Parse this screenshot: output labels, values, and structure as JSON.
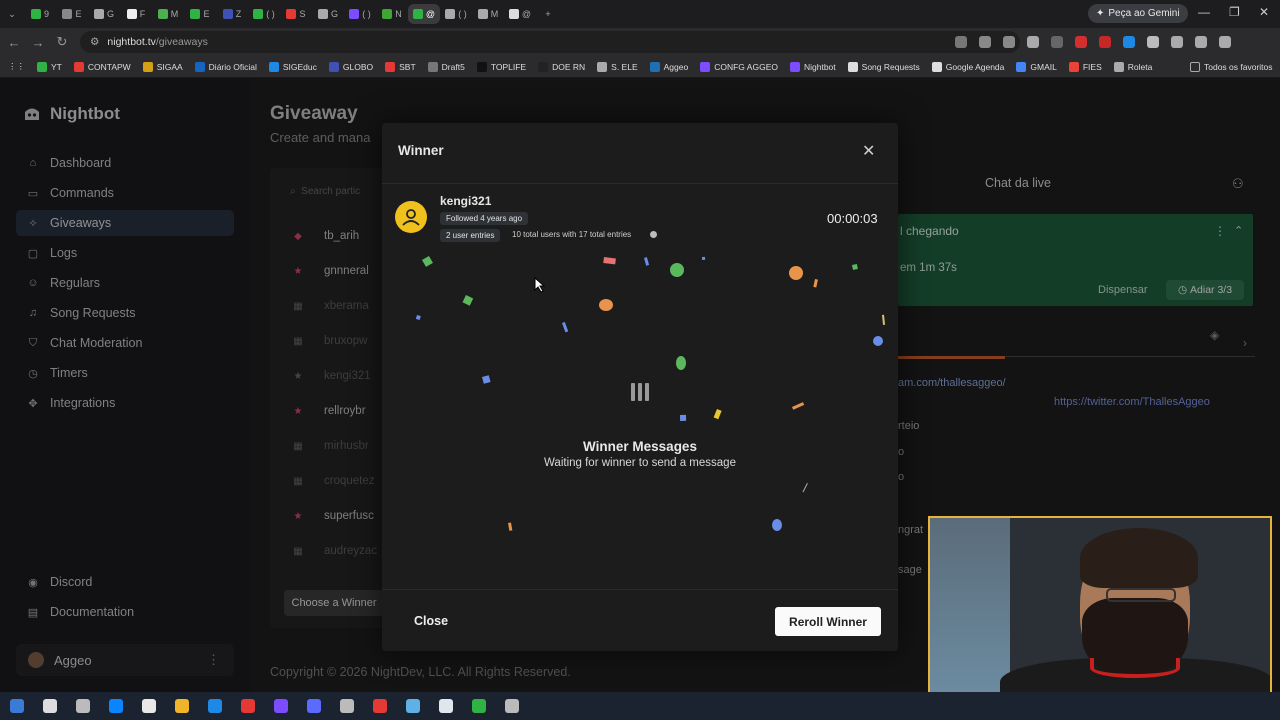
{
  "browser": {
    "url_host": "nightbot.tv",
    "url_path": "/giveaways",
    "gemini_label": "Peça ao Gemini",
    "tabs": [
      "9",
      "Ε",
      "G",
      "F",
      "M",
      "E",
      "Z",
      "( )",
      "S",
      "G",
      "( )",
      "N",
      "@",
      "( )",
      "M",
      "@"
    ],
    "bookmarks": [
      "YT",
      "CONTAPW",
      "SIGAA",
      "Diário Oficial",
      "SIGEduc",
      "GLOBO",
      "SBT",
      "Draft5",
      "TOPLIFE",
      "DOE RN",
      "S. ELE",
      "Aggeo",
      "CONFG AGGEO",
      "Nightbot",
      "Song Requests",
      "Google Agenda",
      "GMAIL",
      "FIES",
      "Roleta"
    ],
    "all_favorites": "Todos os favoritos"
  },
  "sidebar": {
    "logo": "Nightbot",
    "items": [
      {
        "label": "Dashboard",
        "icon": "home-icon"
      },
      {
        "label": "Commands",
        "icon": "terminal-icon"
      },
      {
        "label": "Giveaways",
        "icon": "gift-icon"
      },
      {
        "label": "Logs",
        "icon": "chat-icon"
      },
      {
        "label": "Regulars",
        "icon": "users-icon"
      },
      {
        "label": "Song Requests",
        "icon": "music-icon"
      },
      {
        "label": "Chat Moderation",
        "icon": "shield-icon"
      },
      {
        "label": "Timers",
        "icon": "clock-icon"
      },
      {
        "label": "Integrations",
        "icon": "puzzle-icon"
      }
    ],
    "bottom": [
      "Discord",
      "Documentation"
    ],
    "profile_name": "Aggeo"
  },
  "page": {
    "title": "Giveaway",
    "subtitle": "Create and mana",
    "search_placeholder": "Search partic",
    "entries": [
      {
        "name": "tb_arih",
        "dim": false
      },
      {
        "name": "gnnneral",
        "dim": false
      },
      {
        "name": "xberama",
        "dim": true
      },
      {
        "name": "bruxopw",
        "dim": true
      },
      {
        "name": "kengi321",
        "dim": true
      },
      {
        "name": "rellroybr",
        "dim": false
      },
      {
        "name": "mirhusbr",
        "dim": true
      },
      {
        "name": "croquetez",
        "dim": true
      },
      {
        "name": "superfusc",
        "dim": false
      },
      {
        "name": "audreyzac",
        "dim": true
      }
    ],
    "choose_button": "Choose a Winner",
    "footer": "Copyright © 2026 NightDev, LLC. All Rights Reserved."
  },
  "chat": {
    "title": "Chat da live",
    "alert_line1": "l chegando",
    "alert_line2": "em 1m 37s",
    "dismiss": "Dispensar",
    "postpone": "Adiar 3/3",
    "link_insta": "am.com/thallesaggeo/",
    "link_twitter": "https://twitter.com/ThallesAggeo",
    "fragments": [
      "rteio",
      "o",
      "o",
      "ngrat",
      "sage"
    ]
  },
  "modal": {
    "title": "Winner",
    "winner_name": "kengi321",
    "followed": "Followed 4 years ago",
    "user_entries": "2 user entries",
    "total_entries": "10 total users with 17 total entries",
    "timer": "00:00:03",
    "messages_title": "Winner Messages",
    "messages_sub": "Waiting for winner to send a message",
    "close_button": "Close",
    "reroll_button": "Reroll Winner"
  },
  "colors": {
    "accent_gold": "#f0c11d",
    "webcam_border": "#e8b33a",
    "alert_green": "#1e5a3b"
  }
}
